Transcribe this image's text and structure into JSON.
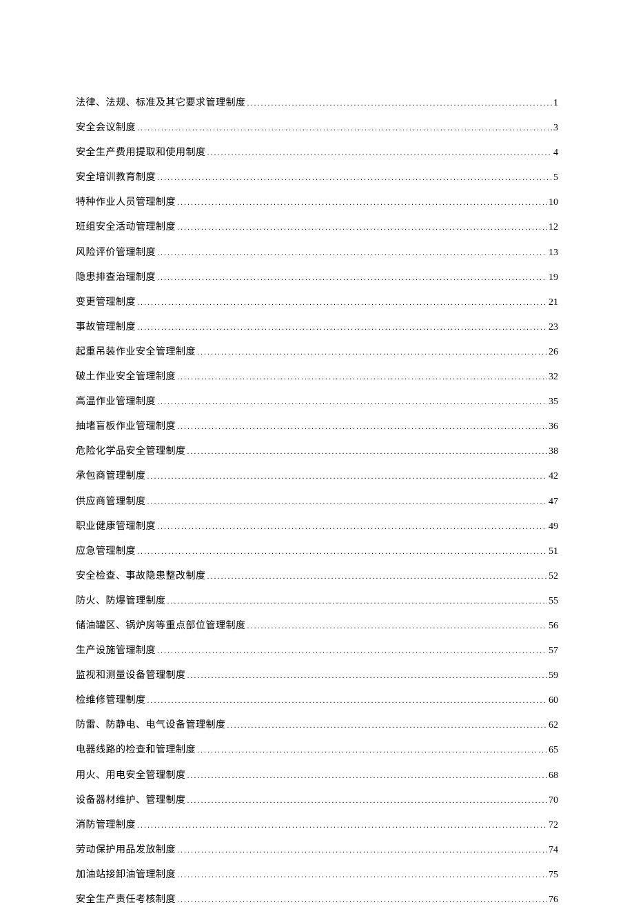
{
  "toc": {
    "entries": [
      {
        "title": "法律、法规、标准及其它要求管理制度",
        "page": "1"
      },
      {
        "title": "安全会议制度",
        "page": "3"
      },
      {
        "title": "安全生产费用提取和使用制度",
        "page": "4"
      },
      {
        "title": "安全培训教育制度",
        "page": "5"
      },
      {
        "title": "特种作业人员管理制度 ",
        "page": "10"
      },
      {
        "title": "班组安全活动管理制度",
        "page": "12"
      },
      {
        "title": "风险评价管理制度",
        "page": "13"
      },
      {
        "title": "隐患排查治理制度",
        "page": "19"
      },
      {
        "title": "变更管理制度",
        "page": "21"
      },
      {
        "title": "事故管理制度",
        "page": "23"
      },
      {
        "title": "起重吊装作业安全管理制度",
        "page": "26"
      },
      {
        "title": "破土作业安全管理制度",
        "page": "32"
      },
      {
        "title": "高温作业管理制度",
        "page": "35"
      },
      {
        "title": "抽堵盲板作业管理制度",
        "page": "36"
      },
      {
        "title": "危险化学品安全管理制度",
        "page": "38"
      },
      {
        "title": "承包商管理制度",
        "page": "42"
      },
      {
        "title": "供应商管理制度",
        "page": "47"
      },
      {
        "title": "职业健康管理制度",
        "page": "49"
      },
      {
        "title": "应急管理制度",
        "page": "51"
      },
      {
        "title": "安全检查、事故隐患整改制度",
        "page": "52"
      },
      {
        "title": "防火、防爆管理制度",
        "page": "55"
      },
      {
        "title": "储油罐区、锅炉房等重点部位管理制度",
        "page": "56"
      },
      {
        "title": "生产设施管理制度",
        "page": "57"
      },
      {
        "title": "监视和测量设备管理制度",
        "page": "59"
      },
      {
        "title": "检维修管理制度",
        "page": "60"
      },
      {
        "title": "防雷、防静电、电气设备管理制度",
        "page": "62"
      },
      {
        "title": "电器线路的检查和管理制度",
        "page": "65"
      },
      {
        "title": "用火、用电安全管理制度",
        "page": "68"
      },
      {
        "title": "设备器材维护、管理制度",
        "page": "70"
      },
      {
        "title": "消防管理制度",
        "page": "72"
      },
      {
        "title": "劳动保护用品发放制度",
        "page": "74"
      },
      {
        "title": "加油站接卸油管理制度",
        "page": "75"
      },
      {
        "title": "安全生产责任考核制度",
        "page": "76"
      }
    ]
  }
}
